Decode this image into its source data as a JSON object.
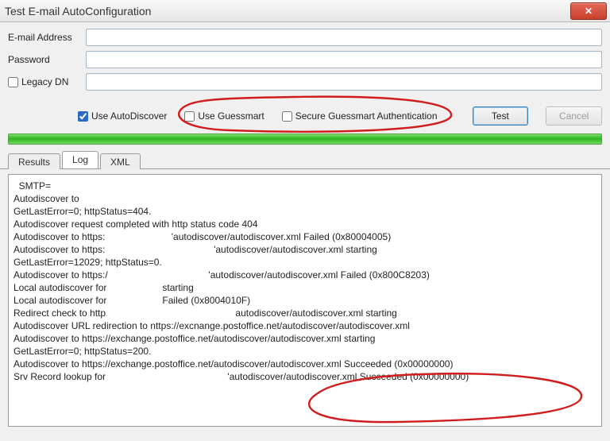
{
  "window": {
    "title": "Test E-mail AutoConfiguration",
    "close_glyph": "✕"
  },
  "form": {
    "email_label": "E-mail Address",
    "email_value": "",
    "password_label": "Password",
    "password_value": "",
    "legacy_dn_label": "Legacy DN",
    "legacy_dn_value": ""
  },
  "options": {
    "use_autodiscover_label": "Use AutoDiscover",
    "use_autodiscover_checked": true,
    "use_guessmart_label": "Use Guessmart",
    "use_guessmart_checked": false,
    "secure_guessmart_label": "Secure Guessmart Authentication",
    "secure_guessmart_checked": false,
    "test_label": "Test",
    "cancel_label": "Cancel"
  },
  "tabs": {
    "results": "Results",
    "log": "Log",
    "xml": "XML",
    "active": "log"
  },
  "log": {
    "lines": [
      "  SMTP=",
      "Autodiscover to",
      "GetLastError=0; httpStatus=404.",
      "Autodiscover request completed with http status code 404",
      "Autodiscover to https:                         'autodiscover/autodiscover.xml Failed (0x80004005)",
      "Autodiscover to https:                                         'autodiscover/autodiscover.xml starting",
      "GetLastError=12029; httpStatus=0.",
      "Autodiscover to https:/                                      'autodiscover/autodiscover.xml Failed (0x800C8203)",
      "Local autodiscover for                     starting",
      "Local autodiscover for                     Failed (0x8004010F)",
      "Redirect check to http                                                 autodiscover/autodiscover.xml starting",
      "Autodiscover URL redirection to nttps://excnange.postoffice.net/autodiscover/autodiscover.xml",
      "Autodiscover to https://exchange.postoffice.net/autodiscover/autodiscover.xml starting",
      "GetLastError=0; httpStatus=200.",
      "Autodiscover to https://exchange.postoffice.net/autodiscover/autodiscover.xml Succeeded (0x00000000)",
      "Srv Record lookup for                                              'autodiscover/autodiscover.xml Succeeded (0x00000000)"
    ]
  }
}
